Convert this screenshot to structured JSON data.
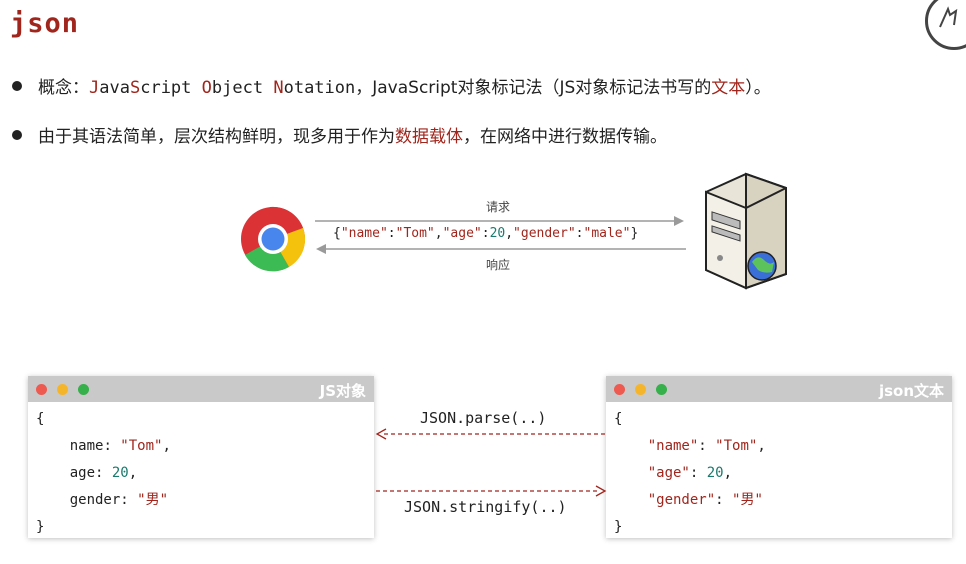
{
  "slide": {
    "title": "json",
    "bullet1": {
      "prefix": "概念：",
      "J": "J",
      "ava": "ava",
      "S": "S",
      "cript": "cript",
      "O": "O",
      "bject": "bject",
      "N": "N",
      "otation": "otation",
      "rest": "，JavaScript对象标记法（JS对象标记法书写的",
      "highlight": "文本",
      "end": "）。"
    },
    "bullet2": {
      "before": "由于其语法简单，层次结构鲜明，现多用于作为",
      "highlight": "数据载体",
      "after": "，在网络中进行数据传输。"
    }
  },
  "diagram": {
    "request_label": "请求",
    "response_label": "响应",
    "payload": {
      "open": "{",
      "k1": "\"name\"",
      "c1": ":",
      "v1": "\"Tom\"",
      "s1": ",",
      "k2": "\"age\"",
      "c2": ":",
      "v2": "20",
      "s2": ",",
      "k3": "\"gender\"",
      "c3": ":",
      "v3": "\"male\"",
      "close": "}"
    },
    "client_icon": "chrome-browser-icon",
    "server_icon": "web-server-icon"
  },
  "panels": {
    "left": {
      "title": "JS对象",
      "open": "{",
      "name_key": "name",
      "name_val": "\"Tom\"",
      "age_key": "age",
      "age_val": "20",
      "gender_key": "gender",
      "gender_val": "\"男\"",
      "close": "}"
    },
    "right": {
      "title": "json文本",
      "open": "{",
      "name_key": "\"name\"",
      "name_val": "\"Tom\"",
      "age_key": "\"age\"",
      "age_val": "20",
      "gender_key": "\"gender\"",
      "gender_val": "\"男\"",
      "close": "}"
    },
    "parse_label": "JSON.parse(..)",
    "stringify_label": "JSON.stringify(..)"
  },
  "colors": {
    "accent": "#a0261d",
    "number": "#1a7a6e",
    "titlebar": "#c9c9c9"
  }
}
